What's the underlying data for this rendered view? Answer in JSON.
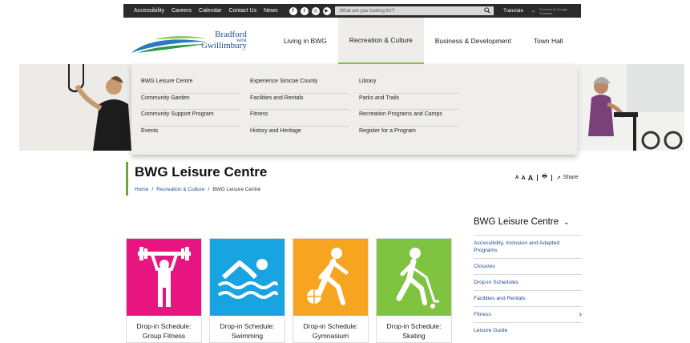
{
  "topbar": {
    "links": [
      "Accessibility",
      "Careers",
      "Calendar",
      "Contact Us",
      "News"
    ],
    "socials": [
      "facebook-icon",
      "twitter-icon",
      "instagram-icon",
      "youtube-icon"
    ],
    "search_placeholder": "What are you looking for?",
    "translate_label": "Translate",
    "powered_label": "Powered by Google Translate"
  },
  "logo": {
    "line1": "Bradford",
    "line2": "west",
    "line3": "Gwillimbury"
  },
  "nav": {
    "items": [
      "Living in BWG",
      "Recreation & Culture",
      "Business & Development",
      "Town Hall"
    ],
    "active_index": 1
  },
  "mega_menu": {
    "col1": [
      "BWG Leisure Centre",
      "Community Garden",
      "Community Support Program",
      "Events"
    ],
    "col2": [
      "Experience Simcoe County",
      "Facilities and Rentals",
      "Fitness",
      "History and Heritage"
    ],
    "col3": [
      "Library",
      "Parks and Trails",
      "Recreation Programs and Camps",
      "Register for a Program"
    ]
  },
  "page": {
    "title": "BWG Leisure Centre",
    "breadcrumb": [
      "Home",
      "Recreation & Culture",
      "BWG Leisure Centre"
    ],
    "font_sizes_label": [
      "A",
      "A",
      "A"
    ],
    "share_label": "Share"
  },
  "tiles": [
    {
      "label_line1": "Drop-in Schedule:",
      "label_line2": "Group Fitness",
      "color": "#e8147f",
      "icon": "weightlifting-icon"
    },
    {
      "label_line1": "Drop-in Schedule:",
      "label_line2": "Swimming",
      "color": "#17a4e0",
      "icon": "swimming-icon"
    },
    {
      "label_line1": "Drop-in Schedule:",
      "label_line2": "Gymnasium",
      "color": "#f7a520",
      "icon": "basketball-icon"
    },
    {
      "label_line1": "Drop-in Schedule:",
      "label_line2": "Skating",
      "color": "#7fc340",
      "icon": "hockey-icon"
    }
  ],
  "sidebar": {
    "title": "BWG Leisure Centre",
    "items": [
      {
        "label": "Accessibility, Inclusion and Adapted Programs"
      },
      {
        "label": "Closures"
      },
      {
        "label": "Drop-in Schedules"
      },
      {
        "label": "Facilities and Rentals"
      },
      {
        "label": "Fitness"
      },
      {
        "label": "Leisure Guide"
      }
    ]
  },
  "colors": {
    "accent_green": "#6aa83a",
    "link_blue": "#1d4d8f",
    "topbar": "#2b2b2b"
  }
}
